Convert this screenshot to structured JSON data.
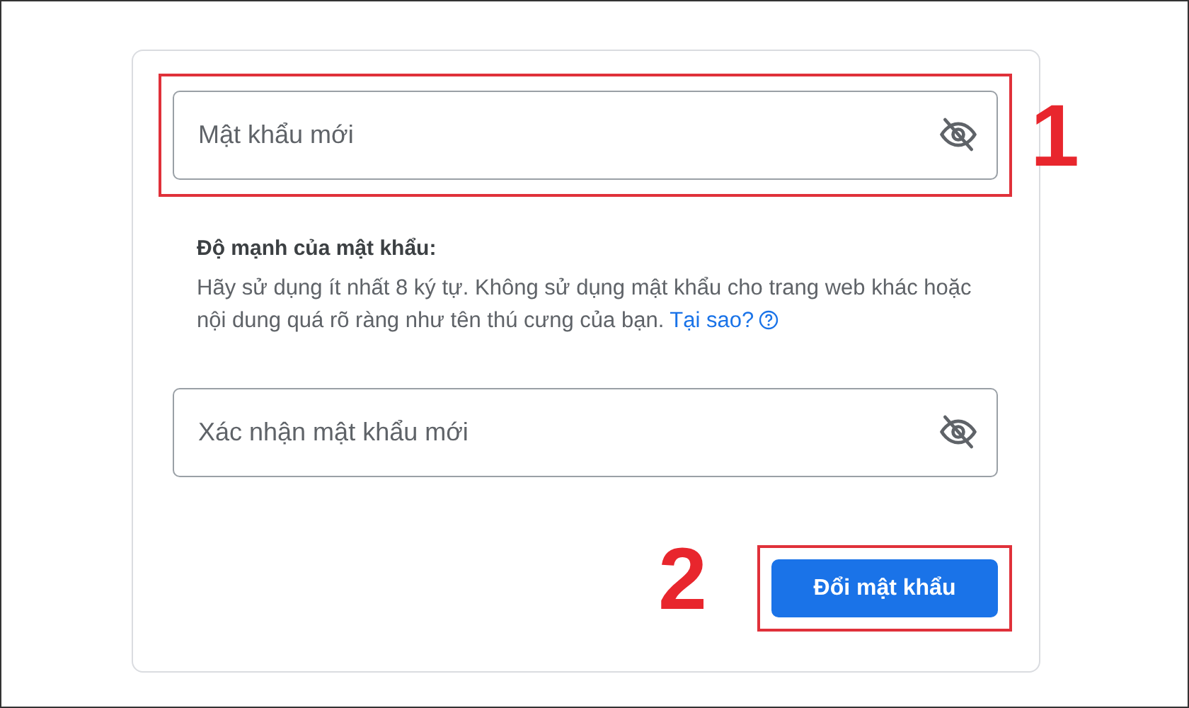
{
  "fields": [
    {
      "placeholder": "Mật khẩu mới",
      "highlighted": true,
      "marker": "1"
    },
    {
      "placeholder": "Xác nhận mật khẩu mới",
      "highlighted": false
    }
  ],
  "strength": {
    "heading": "Độ mạnh của mật khẩu:",
    "text": "Hãy sử dụng ít nhất 8 ký tự. Không sử dụng mật khẩu cho trang web khác hoặc nội dung quá rõ ràng như tên thú cưng của bạn.",
    "link": "Tại sao?"
  },
  "button": {
    "label": "Đổi mật khẩu",
    "highlighted": true,
    "marker": "2"
  }
}
